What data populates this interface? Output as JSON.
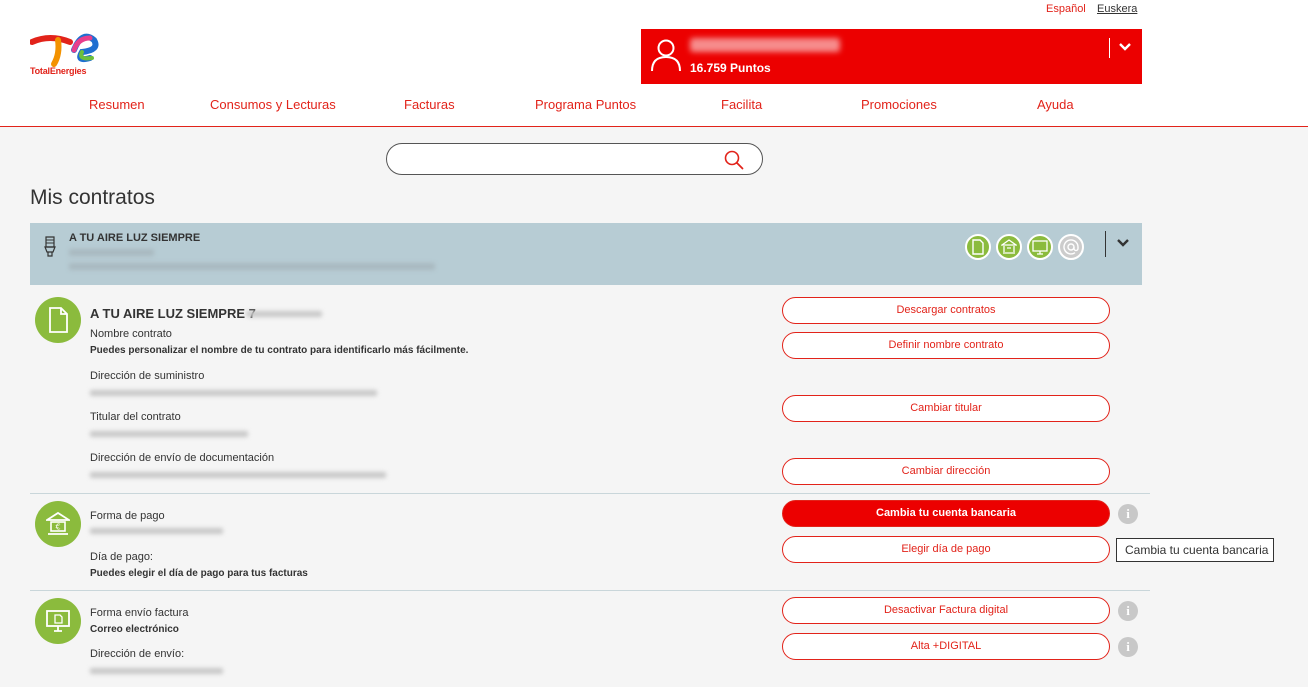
{
  "header": {
    "languages": [
      "Español",
      "Euskera"
    ],
    "logo_text": "TotalEnergies",
    "user": {
      "points": "16.759 Puntos"
    }
  },
  "nav": [
    "Resumen",
    "Consumos y Lecturas",
    "Facturas",
    "Programa Puntos",
    "Facilita",
    "Promociones",
    "Ayuda"
  ],
  "search": {
    "placeholder": ""
  },
  "page_title": "Mis contratos",
  "contract_bar": {
    "name": "A TU AIRE LUZ SIEMPRE"
  },
  "contract_detail": {
    "title": "A TU AIRE LUZ SIEMPRE 7",
    "nombre_label": "Nombre contrato",
    "nombre_hint": "Puedes personalizar el nombre de tu contrato para identificarlo más fácilmente.",
    "direccion_label": "Dirección de suministro",
    "titular_label": "Titular del contrato",
    "envio_doc_label": "Dirección de envío de documentación",
    "buttons": {
      "descargar": "Descargar contratos",
      "definir": "Definir nombre contrato",
      "cambiar_titular": "Cambiar titular",
      "cambiar_direccion": "Cambiar dirección"
    }
  },
  "payment": {
    "forma_label": "Forma de pago",
    "dia_label": "Día de pago:",
    "dia_hint": "Puedes elegir el día de pago para tus facturas",
    "buttons": {
      "cambia_cuenta": "Cambia tu cuenta bancaria",
      "elegir_dia": "Elegir día de pago"
    },
    "tooltip": "Cambia tu cuenta bancaria"
  },
  "invoice": {
    "forma_label": "Forma envío factura",
    "forma_value": "Correo electrónico",
    "direccion_label": "Dirección de envío:",
    "buttons": {
      "desactivar": "Desactivar Factura digital",
      "alta": "Alta +DIGITAL"
    }
  },
  "colors": {
    "brand_red": "#e2231a",
    "user_red": "#ec0000",
    "green": "#8bbb3d",
    "contract_bg": "#b7ccd4"
  },
  "icons": [
    "totalenergies-logo",
    "user-icon",
    "chevron-down-icon",
    "search-icon",
    "lightbulb-icon",
    "document-icon",
    "bank-icon",
    "monitor-icon",
    "at-icon",
    "info-icon"
  ]
}
